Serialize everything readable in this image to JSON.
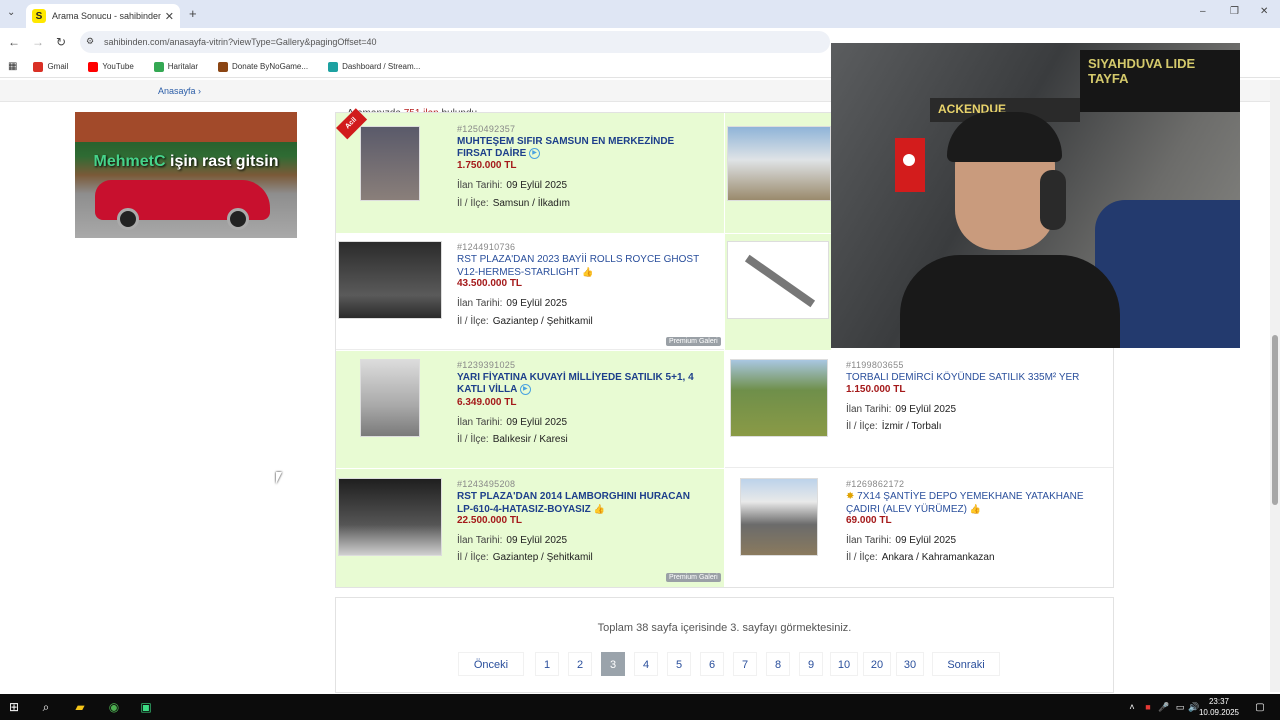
{
  "browser": {
    "tab_title": "Arama Sonucu - sahibinden.co",
    "tab_favicon": "S",
    "url": "sahibinden.com/anasayfa-vitrin?viewType=Gallery&pagingOffset=40",
    "bookmarks": [
      {
        "label": "Gmail",
        "icon": "gmail-icon",
        "color": "#d93025"
      },
      {
        "label": "YouTube",
        "icon": "youtube-icon",
        "color": "#ff0000"
      },
      {
        "label": "Haritalar",
        "icon": "maps-icon",
        "color": "#34a853"
      },
      {
        "label": "Donate ByNoGame...",
        "icon": "donate-icon",
        "color": "#8b4513"
      },
      {
        "label": "Dashboard / Stream...",
        "icon": "dashboard-icon",
        "color": "#1da1a1"
      }
    ]
  },
  "page": {
    "breadcrumb": "Anasayfa",
    "result_prefix": "Aramanızda",
    "result_count": "751 ilan",
    "result_suffix": "bulundu.",
    "ad_caption_highlight": "MehmetC",
    "ad_caption_rest": " işin rast gitsin"
  },
  "listings": [
    {
      "id": "#1250492357",
      "title": "MUHTEŞEM SIFIR SAMSUN EN MERKEZİNDE FIRSAT DAİRE",
      "price": "1.750.000 TL",
      "date_label": "İlan Tarihi:",
      "date": "09 Eylül 2025",
      "loc_label": "İl / İlçe:",
      "location": "Samsun / İlkadım",
      "badge": "Acil"
    },
    {
      "id": "#1244910736",
      "title": "RST PLAZA'DAN 2023 BAYİİ ROLLS ROYCE GHOST V12-HERMES-STARLIGHT",
      "price": "43.500.000 TL",
      "date_label": "İlan Tarihi:",
      "date": "09 Eylül 2025",
      "loc_label": "İl / İlçe:",
      "location": "Gaziantep / Şehitkamil",
      "premium": "Premium Galeri"
    },
    {
      "id": "#1239391025",
      "title": "YARI FİYATINA KUVAYİ MİLLİYEDE SATILIK 5+1, 4 KATLI VİLLA",
      "price": "6.349.000 TL",
      "date_label": "İlan Tarihi:",
      "date": "09 Eylül 2025",
      "loc_label": "İl / İlçe:",
      "location": "Balıkesir / Karesi"
    },
    {
      "id": "#1199803655",
      "title": "TORBALI DEMİRCİ KÖYÜNDE SATILIK 335M² YER",
      "price": "1.150.000 TL",
      "date_label": "İlan Tarihi:",
      "date": "09 Eylül 2025",
      "loc_label": "İl / İlçe:",
      "location": "İzmir / Torbalı"
    },
    {
      "id": "#1243495208",
      "title": "RST PLAZA'DAN 2014 LAMBORGHINI HURACAN LP-610-4-HATASIZ-BOYASIZ",
      "price": "22.500.000 TL",
      "date_label": "İlan Tarihi:",
      "date": "09 Eylül 2025",
      "loc_label": "İl / İlçe:",
      "location": "Gaziantep / Şehitkamil",
      "premium": "Premium Galeri"
    },
    {
      "id": "#1269862172",
      "title": "7x14 ŞANTİYE DEPO YEMEKHANE YATAKHANE ÇADIRI (ALEV YÜRÜMEZ)",
      "price": "69.000 TL",
      "date_label": "İlan Tarihi:",
      "date": "09 Eylül 2025",
      "loc_label": "İl / İlçe:",
      "location": "Ankara / Kahramankazan"
    }
  ],
  "pager": {
    "info": "Toplam 38 sayfa içerisinde 3. sayfayı görmektesiniz.",
    "prev": "Önceki",
    "next": "Sonraki",
    "pages": [
      "1",
      "2",
      "3",
      "4",
      "5",
      "6",
      "7",
      "8",
      "9",
      "10",
      "20",
      "30"
    ],
    "current": "3"
  },
  "webcam": {
    "banner_text": "SIYAHDUVA LIDE TAYFA",
    "wall_text": "ACKENDUE"
  },
  "taskbar": {
    "time": "23:37",
    "date": "10.09.2025"
  },
  "colors": {
    "highlight_row": "#e8fbd3",
    "price": "#a4191a",
    "title": "#1d3f8b",
    "current_page": "#9aa3ab"
  }
}
